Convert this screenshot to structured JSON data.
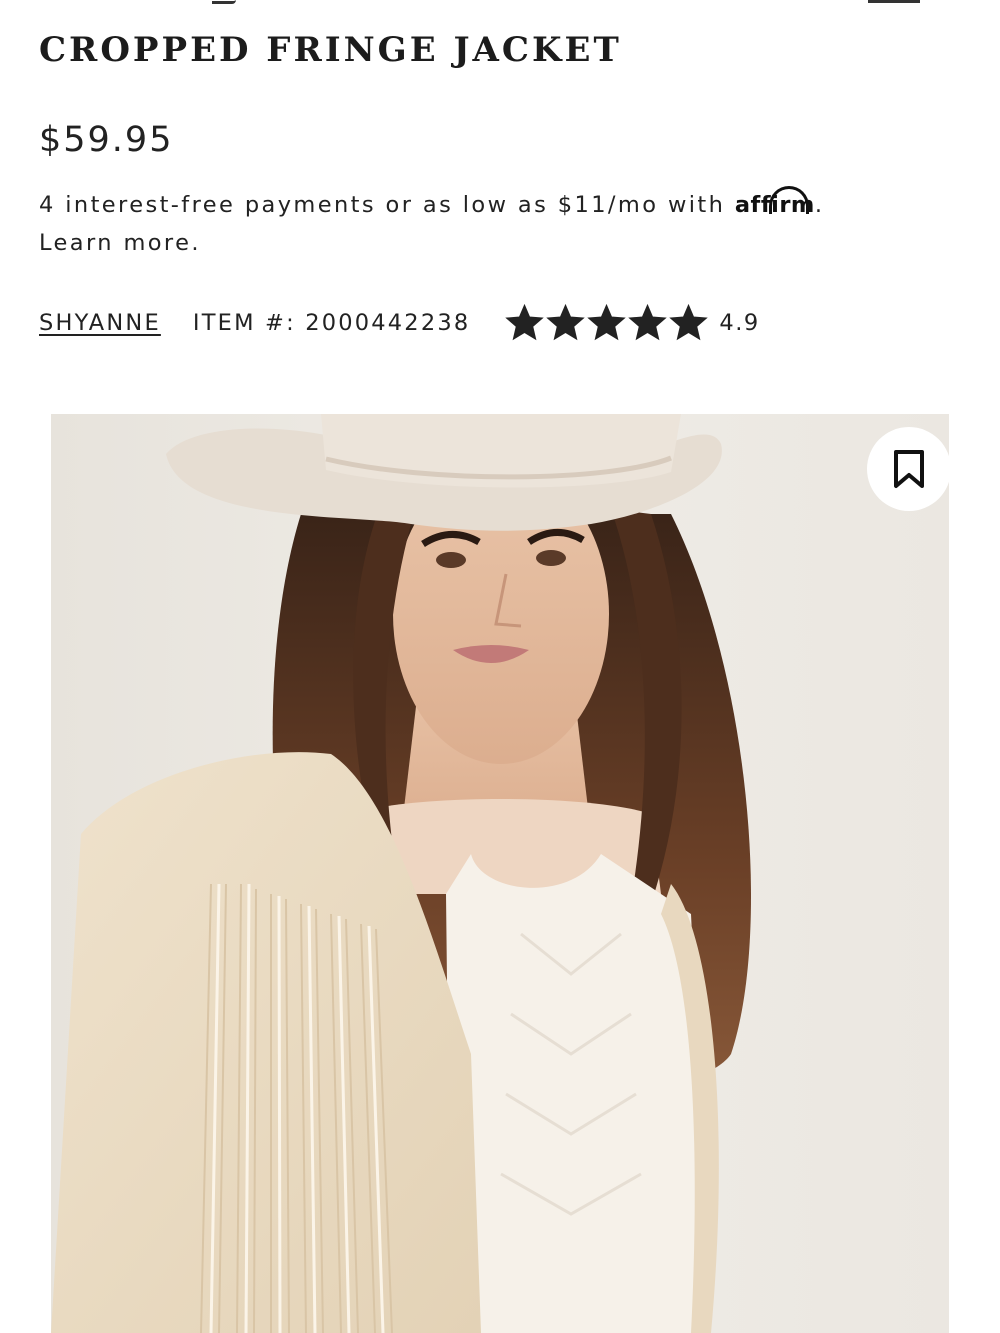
{
  "product": {
    "title": "CROPPED FRINGE JACKET",
    "price": "$59.95",
    "brand": "SHYANNE",
    "item_number": "ITEM #: 2000442238",
    "rating": {
      "value": "4.9",
      "stars_filled": 5,
      "stars_total": 5
    }
  },
  "financing": {
    "text": "4 interest-free payments or as low as $11/mo with ",
    "provider_logo": "affirm",
    "provider_logo_text": "affirm",
    "suffix": ".",
    "learn_more": "Learn more."
  },
  "hero_image": {
    "icon": "bookmark-icon"
  },
  "colors": {
    "text": "#222222",
    "image_background": "#ece8e1",
    "star": "#222222"
  }
}
